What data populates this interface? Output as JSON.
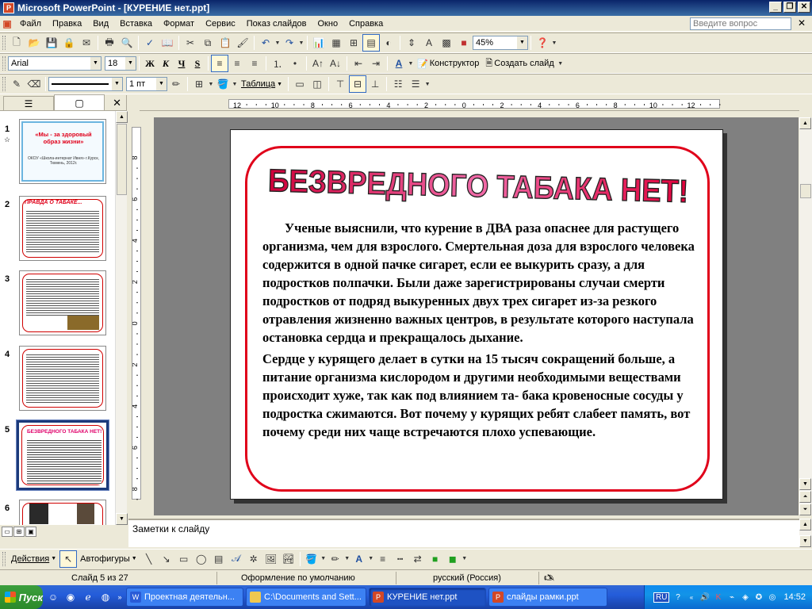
{
  "window": {
    "title": "Microsoft PowerPoint - [КУРЕНИЕ нет.ppt]"
  },
  "menu": {
    "items": [
      "Файл",
      "Правка",
      "Вид",
      "Вставка",
      "Формат",
      "Сервис",
      "Показ слайдов",
      "Окно",
      "Справка"
    ],
    "help_placeholder": "Введите вопрос"
  },
  "standard_toolbar": {
    "zoom": "45%"
  },
  "formatting_toolbar": {
    "font": "Arial",
    "size": "18",
    "bold": "Ж",
    "italic": "К",
    "underline": "Ч",
    "shadow": "S",
    "designer": "Конструктор",
    "new_slide": "Создать слайд"
  },
  "tables_toolbar": {
    "line_width": "1 пт",
    "table_menu": "Таблица"
  },
  "slide_pane": {
    "thumbs": [
      {
        "num": "1",
        "title": "«Мы - за здоровый образ жизни»",
        "subtitle": "ОКОУ «Школа-интернат Ивня» г.Курск, Тюмень, 2012г."
      },
      {
        "num": "2",
        "title": "ПРАВДА О ТАБАКЕ..."
      },
      {
        "num": "3"
      },
      {
        "num": "4"
      },
      {
        "num": "5",
        "title": "БЕЗВРЕДНОГО ТАБАКА НЕТ!"
      },
      {
        "num": "6"
      }
    ]
  },
  "ruler": {
    "h_labels": [
      "12",
      "10",
      "8",
      "6",
      "4",
      "2",
      "0",
      "2",
      "4",
      "6",
      "8",
      "10",
      "12"
    ],
    "v_labels": [
      "8",
      "6",
      "4",
      "2",
      "0",
      "2",
      "4",
      "6",
      "8"
    ]
  },
  "slide": {
    "headline": "БЕЗВРЕДНОГО ТАБАКА НЕТ!",
    "paragraph1": "Ученые выяснили, что курение в ДВА раза опаснее для растущего организма, чем для взрослого. Смертельная доза для взрослого человека содержится в одной пачке сигарет, если ее выкурить сразу, а для подростков полпачки. Были даже зарегистрированы случаи смерти подростков от подряд выкуренных двух трех сигарет из-за резкого отравления жизненно важных центров, в результате которого наступала остановка сердца и прекращалось дыхание.",
    "paragraph2": "Сердце  у курящего делает в сутки на  15  тысяч сокращений больше, а питание организма кислородом и другими необходимыми веществами происходит хуже, так как под влиянием та- бака кровеносные сосуды у подростка сжимаются. Вот почему у курящих ребят слабеет память, вот почему среди них чаще встречаются плохо успевающие."
  },
  "notes": {
    "placeholder": "Заметки к слайду"
  },
  "drawing_toolbar": {
    "actions": "Действия",
    "autoshapes": "Автофигуры"
  },
  "status": {
    "slide": "Слайд 5 из 27",
    "design": "Оформление по умолчанию",
    "language": "русский (Россия)"
  },
  "taskbar": {
    "start": "Пуск",
    "tasks": [
      {
        "label": "Проектная деятельн...",
        "icon": "word-icon"
      },
      {
        "label": "C:\\Documents and Sett...",
        "icon": "folder-icon"
      },
      {
        "label": "КУРЕНИЕ нет.ppt",
        "icon": "powerpoint-icon",
        "active": true
      },
      {
        "label": "слайды рамки.ppt",
        "icon": "powerpoint-icon"
      }
    ],
    "lang": "RU",
    "clock": "14:52"
  },
  "colors": {
    "frame_red": "#E0001A",
    "title_blue": "#0A246A",
    "taskbar_blue": "#245DDA"
  }
}
